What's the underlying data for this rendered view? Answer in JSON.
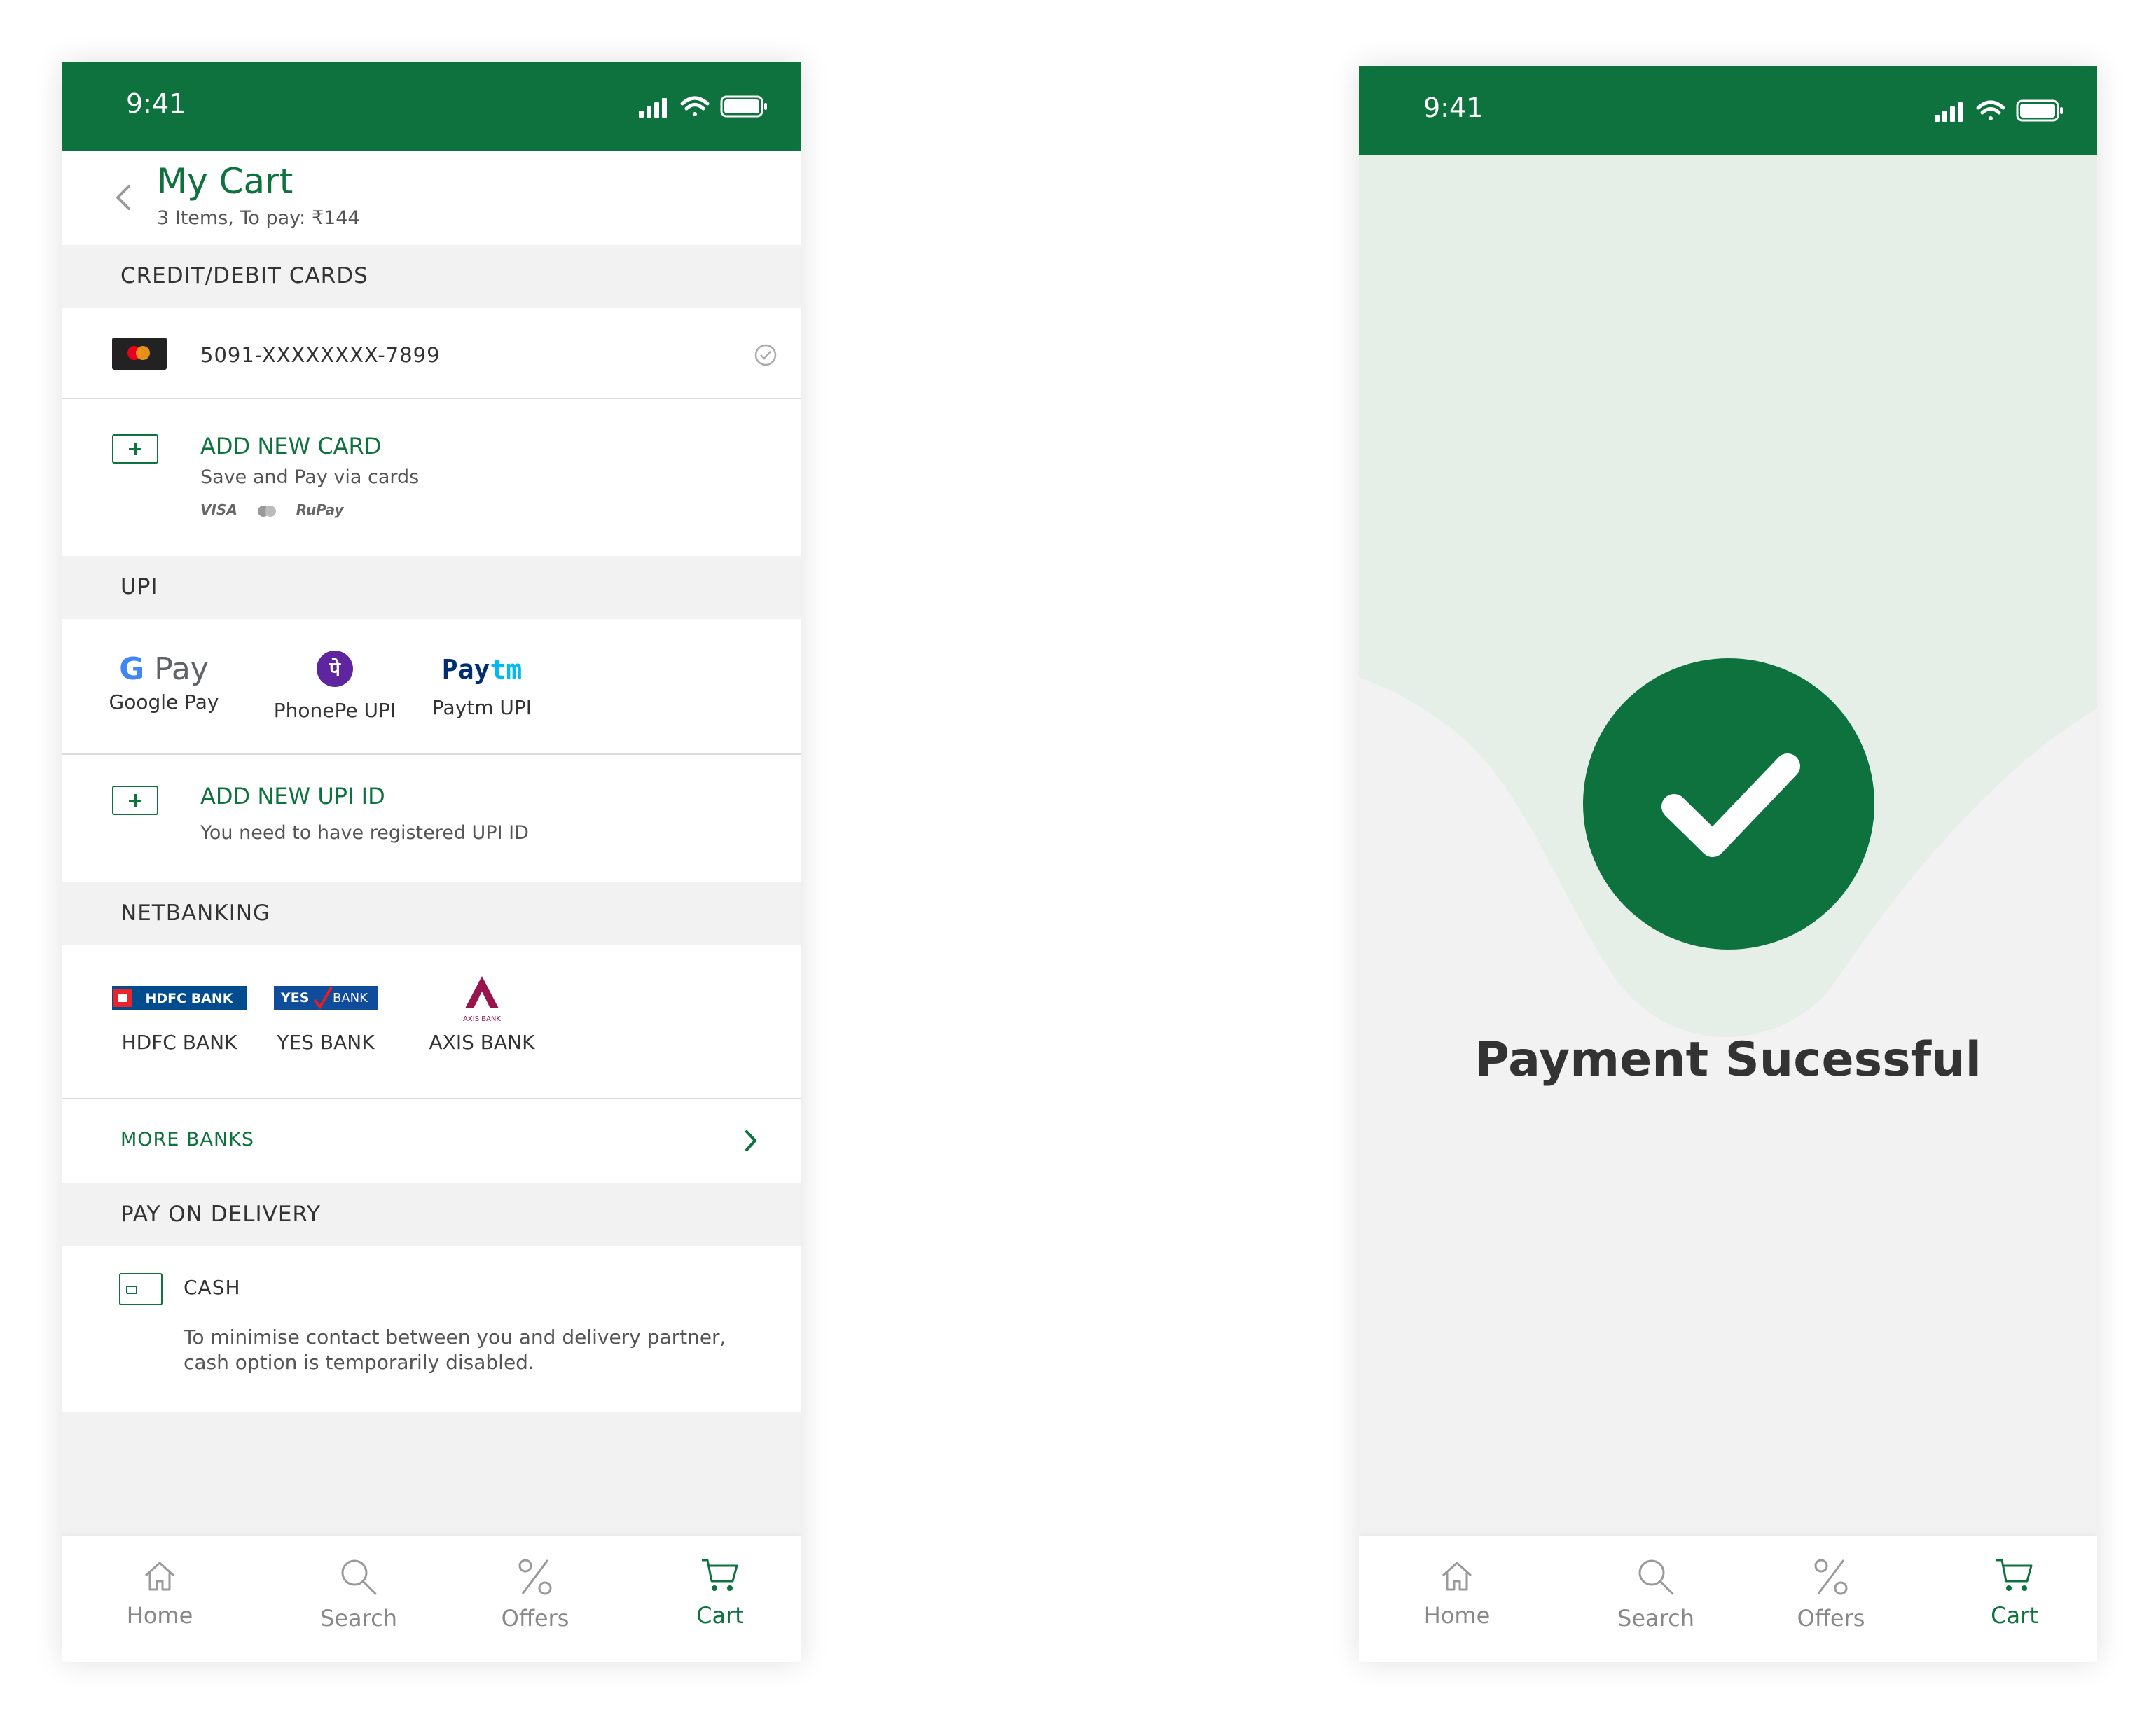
{
  "status_time": "9:41",
  "cart": {
    "title": "My Cart",
    "subtitle": "3 Items, To pay: ₹144",
    "cards_header": "CREDIT/DEBIT CARDS",
    "saved_card": "5091-XXXXXXXX-7899",
    "add_card": {
      "title": "ADD NEW CARD",
      "subtitle": "Save and Pay via cards",
      "networks": [
        "VISA",
        "RuPay"
      ]
    },
    "upi_header": "UPI",
    "upi_apps": [
      {
        "logo": "G Pay",
        "label": "Google Pay"
      },
      {
        "logo": "पे",
        "label": "PhonePe UPI"
      },
      {
        "logo": "Paytm",
        "label": "Paytm UPI"
      }
    ],
    "add_upi": {
      "title": "ADD NEW UPI ID",
      "subtitle": "You need to have registered UPI ID"
    },
    "netbanking_header": "NETBANKING",
    "banks": [
      {
        "logo": "HDFC BANK",
        "label": "HDFC BANK"
      },
      {
        "logo": "YES BANK",
        "label": "YES BANK"
      },
      {
        "logo": "AXIS BANK",
        "label": "AXIS BANK"
      }
    ],
    "more_banks": "MORE BANKS",
    "pod_header": "PAY ON DELIVERY",
    "cash": {
      "label": "CASH",
      "note": "To minimise contact between you and delivery partner, cash option is temporarily disabled."
    }
  },
  "success": {
    "message": "Payment Sucessful"
  },
  "tabs": [
    {
      "label": "Home",
      "icon": "home-icon"
    },
    {
      "label": "Search",
      "icon": "search-icon"
    },
    {
      "label": "Offers",
      "icon": "percent-icon"
    },
    {
      "label": "Cart",
      "icon": "cart-icon",
      "active": true
    }
  ],
  "colors": {
    "brand": "#0d723d",
    "background": "#f2f2f2"
  }
}
